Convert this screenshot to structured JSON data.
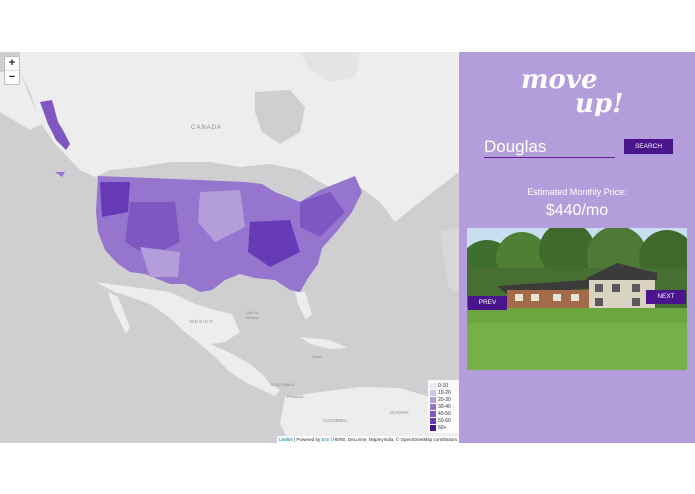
{
  "map": {
    "zoom_in": "+",
    "zoom_out": "−",
    "labels": {
      "canada": "CANADA",
      "mexico": "MÉXICO",
      "gulf": "Gulf of Mexico",
      "cuba": "Cuba",
      "colombia": "COLOMBIA",
      "guyana": "GUYANA",
      "panama": "PANAMÁ",
      "guatemala": "GUATEMALA"
    },
    "legend": [
      {
        "label": "0-10",
        "color": "#ede7f6"
      },
      {
        "label": "10-20",
        "color": "#d1c4e9"
      },
      {
        "label": "20-30",
        "color": "#b39ddb"
      },
      {
        "label": "30-40",
        "color": "#9575cd"
      },
      {
        "label": "40-50",
        "color": "#7e57c2"
      },
      {
        "label": "50-60",
        "color": "#673ab7"
      },
      {
        "label": "60+",
        "color": "#4a148c"
      }
    ],
    "attribution": {
      "leaflet": "Leaflet",
      "powered": " | Powered by ",
      "esri": "Esri",
      "rest": " | HERE, DeLorme, MapmyIndia, © OpenStreetMap contributors"
    }
  },
  "panel": {
    "logo_line1": "move",
    "logo_line2": "up!",
    "search_value": "Douglas",
    "search_button": "SEARCH",
    "estimate_label": "Estimated Monthly Price:",
    "estimate_value": "$440/mo",
    "prev_label": "PREV",
    "next_label": "NEXT"
  },
  "colors": {
    "panel_bg": "#b39ddb",
    "button_bg": "#4a148c",
    "map_bg": "#cfcfd1",
    "land": "#ededed"
  }
}
